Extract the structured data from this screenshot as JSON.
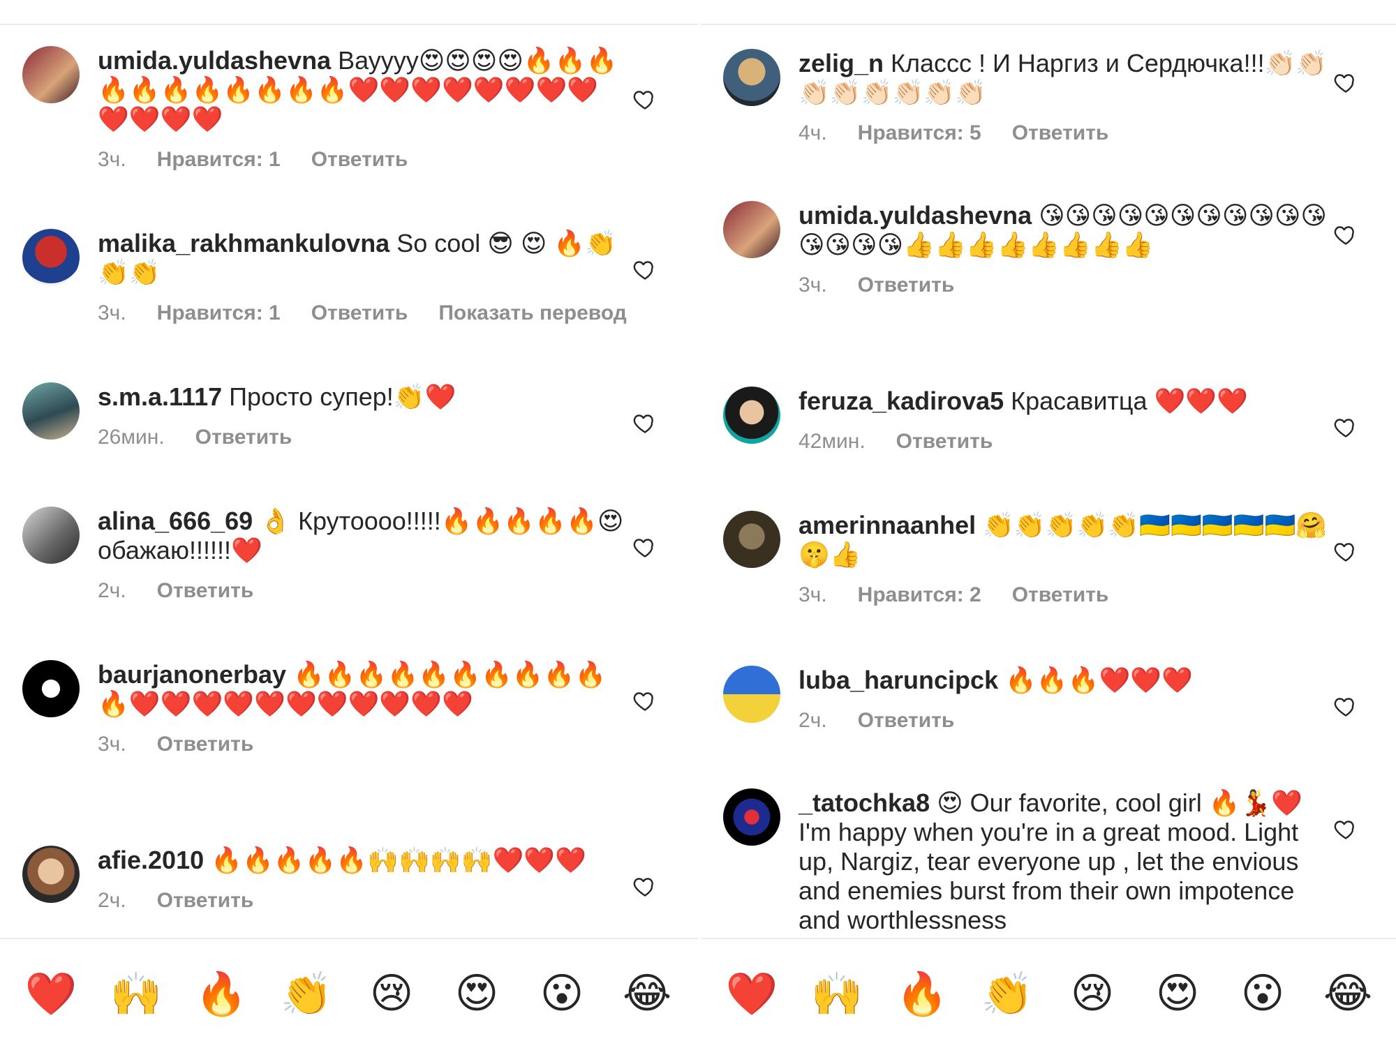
{
  "left": {
    "comments": [
      {
        "user": "umida.yuldashevna",
        "text": " Вауууу😍😍😍😍🔥🔥🔥🔥🔥🔥🔥🔥🔥🔥🔥❤️❤️❤️❤️❤️❤️❤️❤️❤️❤️❤️❤️",
        "time": "3ч.",
        "likes": "Нравится: 1",
        "reply": "Ответить",
        "translate": ""
      },
      {
        "user": "malika_rakhmankulovna",
        "text": " So cool 😎 😍 🔥👏👏👏",
        "time": "3ч.",
        "likes": "Нравится: 1",
        "reply": "Ответить",
        "translate": "Показать перевод"
      },
      {
        "user": "s.m.a.1117",
        "text": " Просто супер!👏❤️",
        "time": "26мин.",
        "likes": "",
        "reply": "Ответить",
        "translate": ""
      },
      {
        "user": "alina_666_69",
        "text": " 👌 Крутоооо!!!!!🔥🔥🔥🔥🔥😍 обажаю!!!!!!❤️",
        "time": "2ч.",
        "likes": "",
        "reply": "Ответить",
        "translate": ""
      },
      {
        "user": "baurjanonerbay",
        "text": " 🔥🔥🔥🔥🔥🔥🔥🔥🔥🔥🔥❤️❤️❤️❤️❤️❤️❤️❤️❤️❤️❤️",
        "time": "3ч.",
        "likes": "",
        "reply": "Ответить",
        "translate": ""
      },
      {
        "user": "afie.2010",
        "text": " 🔥🔥🔥🔥🔥🙌🙌🙌🙌❤️❤️❤️",
        "time": "2ч.",
        "likes": "",
        "reply": "Ответить",
        "translate": ""
      }
    ]
  },
  "right": {
    "comments": [
      {
        "user": "zelig_n",
        "text": " Классс ! И Наргиз и Сердючка!!!👏🏻👏🏻👏🏻👏🏻👏🏻👏🏻👏🏻👏🏻",
        "time": "4ч.",
        "likes": "Нравится: 5",
        "reply": "Ответить",
        "translate": ""
      },
      {
        "user": "umida.yuldashevna",
        "text": " 😘😘😘😘😘😘😘😘😘😘😘😘😘😘😘👍👍👍👍👍👍👍👍",
        "time": "3ч.",
        "likes": "",
        "reply": "Ответить",
        "translate": ""
      },
      {
        "user": "feruza_kadirova5",
        "text": " Красавитца ❤️❤️❤️",
        "time": "42мин.",
        "likes": "",
        "reply": "Ответить",
        "translate": ""
      },
      {
        "user": "amerinnaanhel",
        "text": " 👏👏👏👏👏🇺🇦🇺🇦🇺🇦🇺🇦🇺🇦🤗🤫👍",
        "time": "3ч.",
        "likes": "Нравится: 2",
        "reply": "Ответить",
        "translate": ""
      },
      {
        "user": "luba_haruncipck",
        "text": " 🔥🔥🔥❤️❤️❤️",
        "time": "2ч.",
        "likes": "",
        "reply": "Ответить",
        "translate": ""
      },
      {
        "user": "_tatochka8",
        "text": " 😍 Our favorite, cool girl 🔥💃❤️ I'm happy when you're in a great mood. Light up, Nargiz, tear everyone up , let the envious and enemies burst from their own impotence and worthlessness",
        "time": "",
        "likes": "",
        "reply": "",
        "translate": ""
      }
    ]
  },
  "emoji_bar": [
    "❤️",
    "🙌",
    "🔥",
    "👏",
    "😢",
    "😍",
    "😮",
    "😂"
  ],
  "colors": {
    "text": "#262626",
    "meta": "#8e8e8e",
    "divider": "#ececec",
    "background": "#ffffff"
  }
}
